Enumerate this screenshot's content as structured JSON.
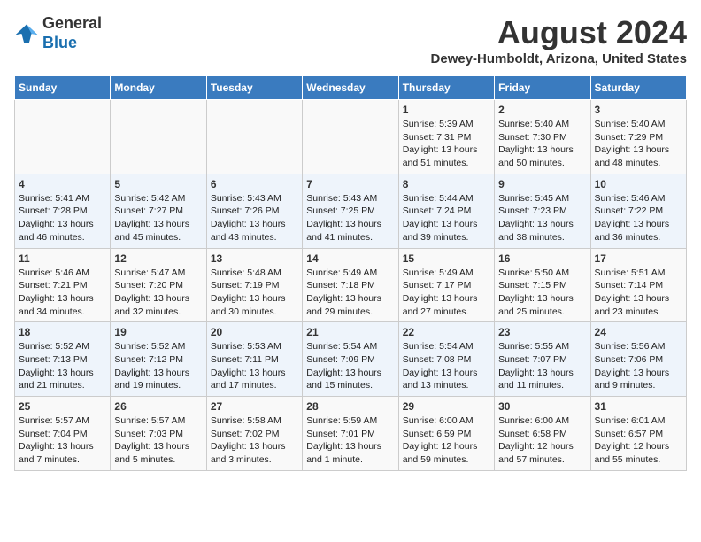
{
  "logo": {
    "general": "General",
    "blue": "Blue"
  },
  "title": "August 2024",
  "subtitle": "Dewey-Humboldt, Arizona, United States",
  "days_of_week": [
    "Sunday",
    "Monday",
    "Tuesday",
    "Wednesday",
    "Thursday",
    "Friday",
    "Saturday"
  ],
  "weeks": [
    [
      {
        "day": "",
        "detail": ""
      },
      {
        "day": "",
        "detail": ""
      },
      {
        "day": "",
        "detail": ""
      },
      {
        "day": "",
        "detail": ""
      },
      {
        "day": "1",
        "detail": "Sunrise: 5:39 AM\nSunset: 7:31 PM\nDaylight: 13 hours\nand 51 minutes."
      },
      {
        "day": "2",
        "detail": "Sunrise: 5:40 AM\nSunset: 7:30 PM\nDaylight: 13 hours\nand 50 minutes."
      },
      {
        "day": "3",
        "detail": "Sunrise: 5:40 AM\nSunset: 7:29 PM\nDaylight: 13 hours\nand 48 minutes."
      }
    ],
    [
      {
        "day": "4",
        "detail": "Sunrise: 5:41 AM\nSunset: 7:28 PM\nDaylight: 13 hours\nand 46 minutes."
      },
      {
        "day": "5",
        "detail": "Sunrise: 5:42 AM\nSunset: 7:27 PM\nDaylight: 13 hours\nand 45 minutes."
      },
      {
        "day": "6",
        "detail": "Sunrise: 5:43 AM\nSunset: 7:26 PM\nDaylight: 13 hours\nand 43 minutes."
      },
      {
        "day": "7",
        "detail": "Sunrise: 5:43 AM\nSunset: 7:25 PM\nDaylight: 13 hours\nand 41 minutes."
      },
      {
        "day": "8",
        "detail": "Sunrise: 5:44 AM\nSunset: 7:24 PM\nDaylight: 13 hours\nand 39 minutes."
      },
      {
        "day": "9",
        "detail": "Sunrise: 5:45 AM\nSunset: 7:23 PM\nDaylight: 13 hours\nand 38 minutes."
      },
      {
        "day": "10",
        "detail": "Sunrise: 5:46 AM\nSunset: 7:22 PM\nDaylight: 13 hours\nand 36 minutes."
      }
    ],
    [
      {
        "day": "11",
        "detail": "Sunrise: 5:46 AM\nSunset: 7:21 PM\nDaylight: 13 hours\nand 34 minutes."
      },
      {
        "day": "12",
        "detail": "Sunrise: 5:47 AM\nSunset: 7:20 PM\nDaylight: 13 hours\nand 32 minutes."
      },
      {
        "day": "13",
        "detail": "Sunrise: 5:48 AM\nSunset: 7:19 PM\nDaylight: 13 hours\nand 30 minutes."
      },
      {
        "day": "14",
        "detail": "Sunrise: 5:49 AM\nSunset: 7:18 PM\nDaylight: 13 hours\nand 29 minutes."
      },
      {
        "day": "15",
        "detail": "Sunrise: 5:49 AM\nSunset: 7:17 PM\nDaylight: 13 hours\nand 27 minutes."
      },
      {
        "day": "16",
        "detail": "Sunrise: 5:50 AM\nSunset: 7:15 PM\nDaylight: 13 hours\nand 25 minutes."
      },
      {
        "day": "17",
        "detail": "Sunrise: 5:51 AM\nSunset: 7:14 PM\nDaylight: 13 hours\nand 23 minutes."
      }
    ],
    [
      {
        "day": "18",
        "detail": "Sunrise: 5:52 AM\nSunset: 7:13 PM\nDaylight: 13 hours\nand 21 minutes."
      },
      {
        "day": "19",
        "detail": "Sunrise: 5:52 AM\nSunset: 7:12 PM\nDaylight: 13 hours\nand 19 minutes."
      },
      {
        "day": "20",
        "detail": "Sunrise: 5:53 AM\nSunset: 7:11 PM\nDaylight: 13 hours\nand 17 minutes."
      },
      {
        "day": "21",
        "detail": "Sunrise: 5:54 AM\nSunset: 7:09 PM\nDaylight: 13 hours\nand 15 minutes."
      },
      {
        "day": "22",
        "detail": "Sunrise: 5:54 AM\nSunset: 7:08 PM\nDaylight: 13 hours\nand 13 minutes."
      },
      {
        "day": "23",
        "detail": "Sunrise: 5:55 AM\nSunset: 7:07 PM\nDaylight: 13 hours\nand 11 minutes."
      },
      {
        "day": "24",
        "detail": "Sunrise: 5:56 AM\nSunset: 7:06 PM\nDaylight: 13 hours\nand 9 minutes."
      }
    ],
    [
      {
        "day": "25",
        "detail": "Sunrise: 5:57 AM\nSunset: 7:04 PM\nDaylight: 13 hours\nand 7 minutes."
      },
      {
        "day": "26",
        "detail": "Sunrise: 5:57 AM\nSunset: 7:03 PM\nDaylight: 13 hours\nand 5 minutes."
      },
      {
        "day": "27",
        "detail": "Sunrise: 5:58 AM\nSunset: 7:02 PM\nDaylight: 13 hours\nand 3 minutes."
      },
      {
        "day": "28",
        "detail": "Sunrise: 5:59 AM\nSunset: 7:01 PM\nDaylight: 13 hours\nand 1 minute."
      },
      {
        "day": "29",
        "detail": "Sunrise: 6:00 AM\nSunset: 6:59 PM\nDaylight: 12 hours\nand 59 minutes."
      },
      {
        "day": "30",
        "detail": "Sunrise: 6:00 AM\nSunset: 6:58 PM\nDaylight: 12 hours\nand 57 minutes."
      },
      {
        "day": "31",
        "detail": "Sunrise: 6:01 AM\nSunset: 6:57 PM\nDaylight: 12 hours\nand 55 minutes."
      }
    ]
  ]
}
